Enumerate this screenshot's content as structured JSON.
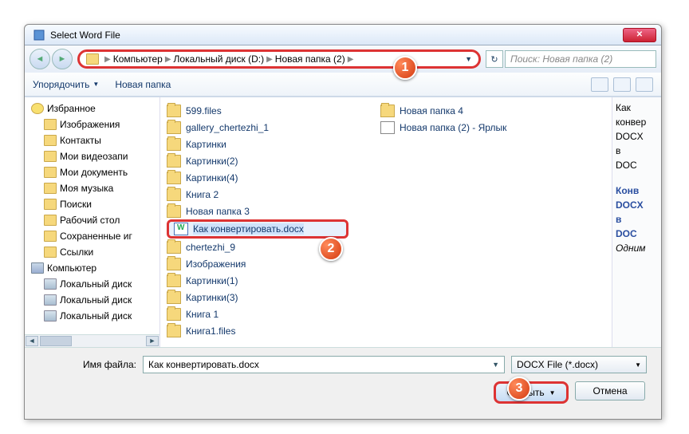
{
  "window": {
    "title": "Select Word File"
  },
  "breadcrumb": {
    "root": "Компьютер",
    "drive": "Локальный диск (D:)",
    "folder": "Новая папка (2)"
  },
  "search": {
    "placeholder": "Поиск: Новая папка (2)"
  },
  "toolbar": {
    "organize": "Упорядочить",
    "newfolder": "Новая папка"
  },
  "tree": {
    "fav": "Избранное",
    "items": [
      "Изображения",
      "Контакты",
      "Мои видеозапи",
      "Мои документь",
      "Моя музыка",
      "Поиски",
      "Рабочий стол",
      "Сохраненные иг",
      "Ссылки"
    ],
    "computer": "Компьютер",
    "drives": [
      "Локальный диск",
      "Локальный диск",
      "Локальный диск"
    ]
  },
  "files": {
    "col1": [
      {
        "t": "folder",
        "n": "599.files"
      },
      {
        "t": "folder",
        "n": "gallery_chertezhi_1"
      },
      {
        "t": "folder",
        "n": "Картинки"
      },
      {
        "t": "folder",
        "n": "Картинки(2)"
      },
      {
        "t": "folder",
        "n": "Картинки(4)"
      },
      {
        "t": "folder",
        "n": "Книга 2"
      },
      {
        "t": "folder",
        "n": "Новая папка 3"
      },
      {
        "t": "doc",
        "n": "Как конвертировать.docx",
        "sel": true
      }
    ],
    "col2": [
      {
        "t": "folder",
        "n": "chertezhi_9"
      },
      {
        "t": "folder",
        "n": "Изображения"
      },
      {
        "t": "folder",
        "n": "Картинки(1)"
      },
      {
        "t": "folder",
        "n": "Картинки(3)"
      },
      {
        "t": "folder",
        "n": "Книга 1"
      },
      {
        "t": "folder",
        "n": "Книга1.files"
      },
      {
        "t": "folder",
        "n": "Новая папка 4"
      },
      {
        "t": "link",
        "n": "Новая папка (2) - Ярлык"
      }
    ]
  },
  "preview": {
    "l1": "Как",
    "l2": "конвер",
    "l3": "DOCX",
    "l4": "в",
    "l5": "DOC",
    "h1": "Конв",
    "h2": "DOCX",
    "h3": "в",
    "h4": "DOC",
    "i1": "Одним"
  },
  "bottom": {
    "label": "Имя файла:",
    "value": "Как конвертировать.docx",
    "filter": "DOCX File (*.docx)",
    "open": "Открыть",
    "cancel": "Отмена"
  },
  "badges": {
    "b1": "1",
    "b2": "2",
    "b3": "3"
  }
}
